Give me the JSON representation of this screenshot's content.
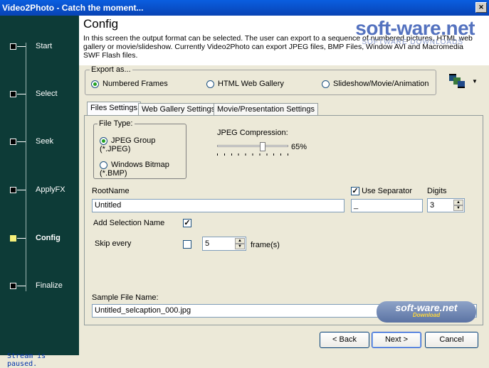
{
  "window": {
    "title": "Video2Photo - Catch the moment..."
  },
  "steps": [
    {
      "label": "Start",
      "active": false
    },
    {
      "label": "Select",
      "active": false
    },
    {
      "label": "Seek",
      "active": false
    },
    {
      "label": "ApplyFX",
      "active": false
    },
    {
      "label": "Config",
      "active": true
    },
    {
      "label": "Finalize",
      "active": false
    }
  ],
  "status": "Stream is paused.",
  "header": {
    "title": "Config",
    "description": "In this screen the output format can be selected. The user can export to a sequence of numbered pictures, HTML web gallery or movie/slideshow. Currently Video2Photo can export JPEG files, BMP Files, Window AVI and Macromedia SWF Flash files."
  },
  "watermark": {
    "brand": "soft-ware.net",
    "sub": "SOFTWARE DOWNLOADS",
    "badge_brand": "soft-ware.net",
    "badge_sub": "Download"
  },
  "export": {
    "legend": "Export as...",
    "options": [
      {
        "label": "Numbered Frames",
        "selected": true
      },
      {
        "label": "HTML Web Gallery",
        "selected": false
      },
      {
        "label": "Slideshow/Movie/Animation",
        "selected": false
      }
    ]
  },
  "tabs": [
    {
      "label": "Files Settings",
      "selected": true
    },
    {
      "label": "Web Gallery Settings",
      "selected": false
    },
    {
      "label": "Movie/Presentation Settings",
      "selected": false
    }
  ],
  "file_type": {
    "legend": "File Type:",
    "options": [
      {
        "label": "JPEG Group (*.JPEG)",
        "selected": true
      },
      {
        "label": "Windows Bitmap (*.BMP)",
        "selected": false
      }
    ]
  },
  "jpeg": {
    "label": "JPEG Compression:",
    "value_text": "65%",
    "value": 0.65
  },
  "rootname": {
    "label": "RootName",
    "value": "Untitled"
  },
  "separator": {
    "label": "Use Separator",
    "checked": true,
    "value": "_"
  },
  "digits": {
    "label": "Digits",
    "value": "3"
  },
  "add_selection": {
    "label": "Add Selection Name",
    "checked": true
  },
  "skip": {
    "label": "Skip every",
    "checked": false,
    "value": "5",
    "unit": "frame(s)"
  },
  "sample": {
    "label": "Sample File Name:",
    "value": "Untitled_selcaption_000.jpg"
  },
  "buttons": {
    "back": "< Back",
    "next": "Next >",
    "cancel": "Cancel"
  },
  "colors": {
    "sidebar": "#0d3b37",
    "active_step": "#f5f07a",
    "titlebar": "#0a5ee0"
  }
}
